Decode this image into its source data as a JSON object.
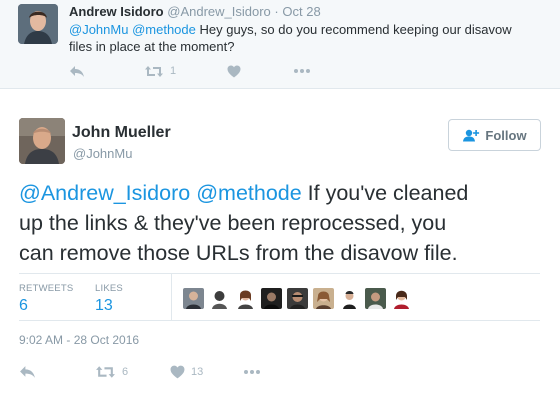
{
  "parent_tweet": {
    "name": "Andrew Isidoro",
    "handle": "@Andrew_Isidoro",
    "separator": "·",
    "time": "Oct 28",
    "mention_1": "@JohnMu",
    "mention_2": "@methode",
    "text_line1_rest": " Hey guys, so do you recommend keeping our disavow",
    "text_line2": "files in place at the moment?",
    "retweet_count": "1",
    "icons": [
      "reply-icon",
      "retweet-icon",
      "heart-icon",
      "more-icon"
    ]
  },
  "main_tweet": {
    "name": "John Mueller",
    "handle": "@JohnMu",
    "follow_label": "Follow",
    "mention_1": "@Andrew_Isidoro",
    "mention_2": "@methode",
    "text_line1_rest": " If you've cleaned",
    "text_line2": "up the links & they've been reprocessed, you",
    "text_line3": "can remove those URLs from the disavow file.",
    "retweets_label": "RETWEETS",
    "retweets_count": "6",
    "likes_label": "LIKES",
    "likes_count": "13",
    "liker_count_shown": 9,
    "timestamp": "9:02 AM - 28 Oct 2016",
    "action_retweet_count": "6",
    "action_like_count": "13",
    "icons": [
      "reply-icon",
      "retweet-icon",
      "heart-icon",
      "more-icon"
    ]
  },
  "colors": {
    "link": "#1b95e0",
    "muted": "#8899a6",
    "icon": "#aab8c2",
    "text": "#292f33",
    "parent_background": "#f5f8fa"
  }
}
